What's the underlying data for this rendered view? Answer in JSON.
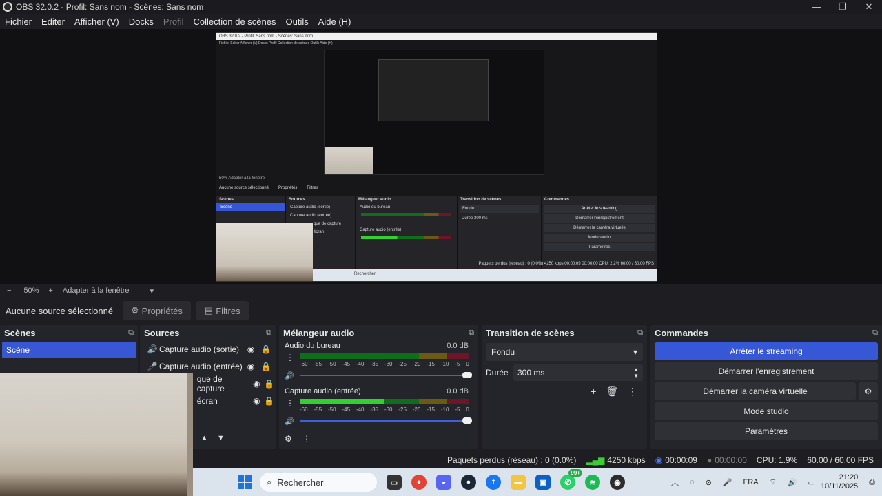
{
  "window": {
    "title": "OBS 32.0.2 - Profil: Sans nom - Scènes: Sans nom",
    "controls": [
      "—",
      "❐",
      "✕"
    ]
  },
  "menu": {
    "items": [
      "Fichier",
      "Editer",
      "Afficher (V)",
      "Docks",
      "Profil",
      "Collection de scènes",
      "Outils",
      "Aide (H)"
    ]
  },
  "zoom": {
    "minus": "−",
    "value": "50%",
    "plus": "+",
    "fit": "Adapter à la fenêtre",
    "arrow": "▾"
  },
  "selection": {
    "none": "Aucune source sélectionné",
    "properties": "Propriétés",
    "filters": "Filtres"
  },
  "scenes": {
    "title": "Scènes",
    "items": [
      "Scène"
    ]
  },
  "sources": {
    "title": "Sources",
    "items": [
      {
        "label": "Capture audio (sortie)",
        "icon": "speaker-icon"
      },
      {
        "label": "Capture audio (entrée)",
        "icon": "microphone-icon"
      },
      {
        "label": "que de capture",
        "icon": "camera-icon"
      },
      {
        "label": "écran",
        "icon": "monitor-icon"
      }
    ]
  },
  "mixer": {
    "title": "Mélangeur audio",
    "scale": [
      "-60",
      "-55",
      "-50",
      "-45",
      "-40",
      "-35",
      "-30",
      "-25",
      "-20",
      "-15",
      "-10",
      "-5",
      "0"
    ],
    "channels": [
      {
        "name": "Audio du bureau",
        "db": "0.0 dB",
        "level": 0
      },
      {
        "name": "Capture audio (entrée)",
        "db": "0.0 dB",
        "level": 0.5
      }
    ]
  },
  "transition": {
    "title": "Transition de scènes",
    "type": "Fondu",
    "duration_label": "Durée",
    "duration_value": "300 ms"
  },
  "controls": {
    "title": "Commandes",
    "buttons": [
      "Arrêter le streaming",
      "Démarrer l'enregistrement",
      "Démarrer la caméra virtuelle",
      "Mode studio",
      "Paramètres"
    ]
  },
  "status": {
    "dropped": "Paquets perdus (réseau) : 0 (0.0%)",
    "bitrate": "4250 kbps",
    "stream_time": "00:00:09",
    "rec_time": "00:00:00",
    "cpu": "CPU: 1.9%",
    "fps": "60.00 / 60.00 FPS"
  },
  "nested": {
    "title": "OBS 32.0.2 - Profil: Sans nom - Scènes: Sans nom",
    "menu": "Fichier   Editer   Afficher (V)   Docks   Profil   Collection de scènes   Outils   Aide (H)",
    "zoom": "50%    Adapter à la fenêtre",
    "nosel": "Aucune source sélectionné",
    "props": "Propriétés",
    "filters": "Filtres",
    "scenes": "Scènes",
    "scene": "Scène",
    "sources": "Sources",
    "src1": "Capture audio (sortie)",
    "src2": "Capture audio (entrée)",
    "src3": "que de capture",
    "src4": "écran",
    "mixer": "Mélangeur audio",
    "ch1": "Audio du bureau",
    "ch2": "Capture audio (entrée)",
    "trans": "Transition de scènes",
    "fondu": "Fondu",
    "duree": "Durée      300 ms",
    "cmds": "Commandes",
    "b1": "Arrêter le streaming",
    "b2": "Démarrer l'enregistrement",
    "b3": "Démarrer la caméra virtuelle",
    "b4": "Mode studio",
    "b5": "Paramètres",
    "status": "Paquets perdus (réseau) : 0 (0.0%)   4250 kbps   00:00:09   00:00:00   CPU: 2.2%   60.00 / 60.00 FPS",
    "search": "Rechercher"
  },
  "taskbar": {
    "search": "Rechercher",
    "badge": "99+",
    "lang": "FRA",
    "time": "21:20",
    "date": "10/11/2025"
  }
}
